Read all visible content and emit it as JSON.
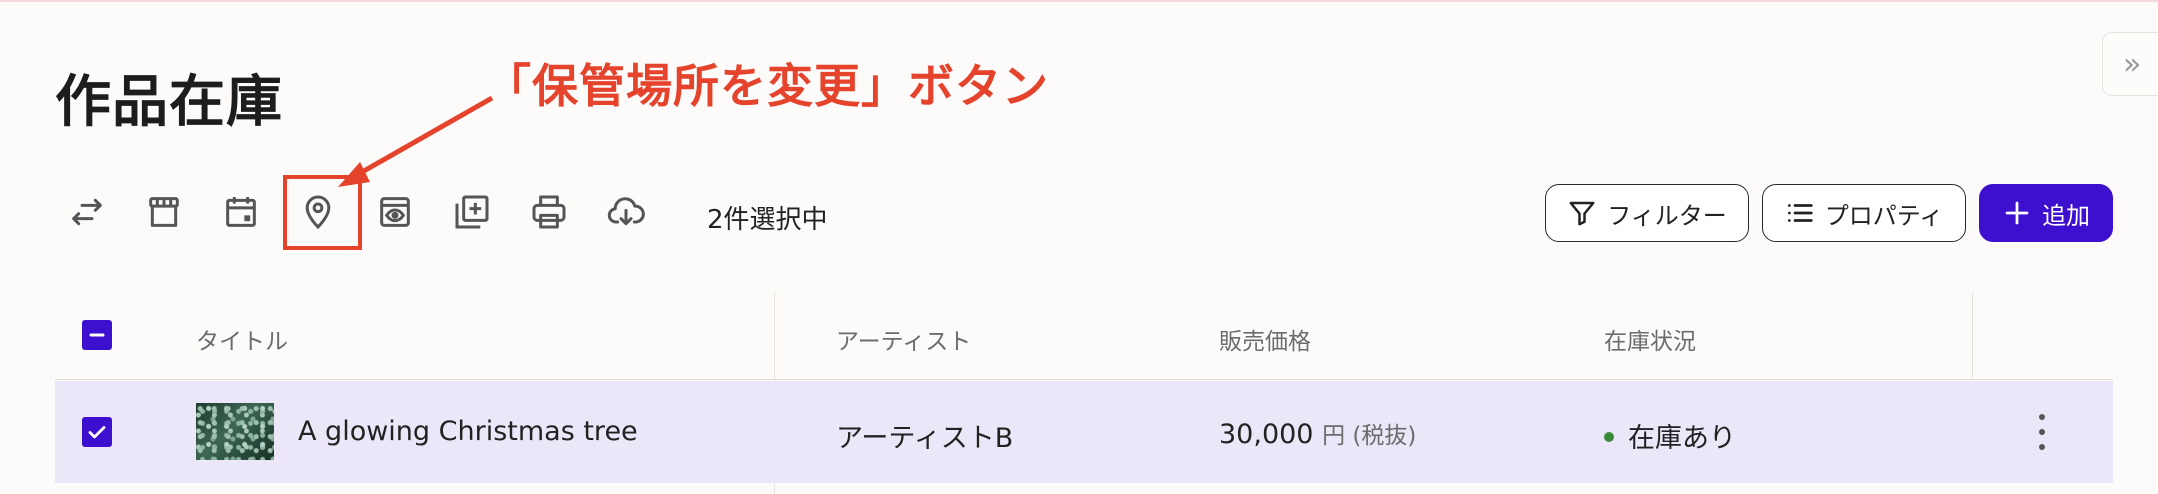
{
  "page": {
    "title": "作品在庫"
  },
  "annotation": {
    "text": "「保管場所を変更」ボタン",
    "color": "#e5432c"
  },
  "toolbar": {
    "icons": [
      {
        "name": "swap-arrows-icon"
      },
      {
        "name": "storefront-icon"
      },
      {
        "name": "calendar-icon"
      },
      {
        "name": "location-pin-icon"
      },
      {
        "name": "preview-eye-icon"
      },
      {
        "name": "add-to-collection-icon"
      },
      {
        "name": "print-icon"
      },
      {
        "name": "cloud-download-icon"
      }
    ],
    "selection_count": "2件選択中",
    "filter_label": "フィルター",
    "properties_label": "プロパティ",
    "add_label": "追加"
  },
  "table": {
    "headers": [
      "タイトル",
      "アーティスト",
      "販売価格",
      "在庫状況"
    ],
    "rows": [
      {
        "title": "A glowing Christmas tree",
        "artist": "アーティストB",
        "price": "30,000",
        "price_unit": "円 (税抜)",
        "stock": "在庫あり",
        "selected": true
      }
    ]
  },
  "colors": {
    "accent": "#3d10cf",
    "row_selected": "#ece7f8",
    "status_in_stock": "#3a8a3a",
    "annotation": "#e5432c"
  }
}
